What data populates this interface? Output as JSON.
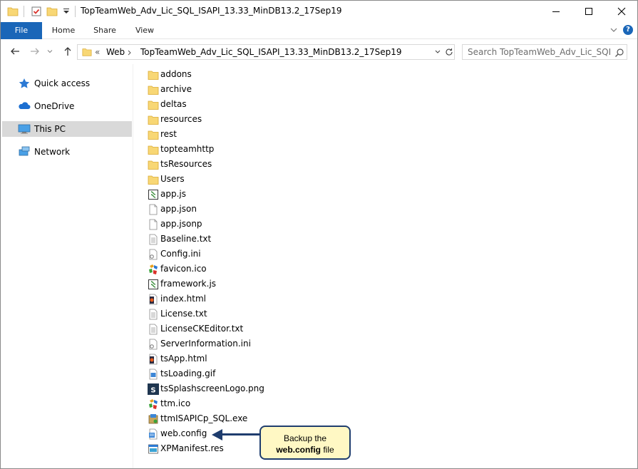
{
  "window": {
    "title": "TopTeamWeb_Adv_Lic_SQL_ISAPI_13.33_MinDB13.2_17Sep19",
    "minimize_icon": "minimize-icon",
    "maximize_icon": "maximize-icon",
    "close_icon": "close-icon"
  },
  "ribbon": {
    "tabs": [
      "File",
      "Home",
      "Share",
      "View"
    ],
    "help_label": "?"
  },
  "address": {
    "overflow": "«",
    "crumbs": [
      "Web",
      "TopTeamWeb_Adv_Lic_SQL_ISAPI_13.33_MinDB13.2_17Sep19"
    ],
    "search_placeholder": "Search TopTeamWeb_Adv_Lic_SQL_I..."
  },
  "navpane": {
    "items": [
      {
        "label": "Quick access",
        "icon": "star-icon"
      },
      {
        "label": "OneDrive",
        "icon": "cloud-icon"
      },
      {
        "label": "This PC",
        "icon": "computer-icon",
        "selected": true
      },
      {
        "label": "Network",
        "icon": "network-icon"
      }
    ]
  },
  "files": [
    {
      "name": "addons",
      "icon": "folder-icon"
    },
    {
      "name": "archive",
      "icon": "folder-icon"
    },
    {
      "name": "deltas",
      "icon": "folder-icon"
    },
    {
      "name": "resources",
      "icon": "folder-icon"
    },
    {
      "name": "rest",
      "icon": "folder-icon"
    },
    {
      "name": "topteamhttp",
      "icon": "folder-icon"
    },
    {
      "name": "tsResources",
      "icon": "folder-icon"
    },
    {
      "name": "Users",
      "icon": "folder-icon"
    },
    {
      "name": "app.js",
      "icon": "script-icon"
    },
    {
      "name": "app.json",
      "icon": "blank-file-icon"
    },
    {
      "name": "app.jsonp",
      "icon": "blank-file-icon"
    },
    {
      "name": "Baseline.txt",
      "icon": "text-file-icon"
    },
    {
      "name": "Config.ini",
      "icon": "settings-file-icon"
    },
    {
      "name": "favicon.ico",
      "icon": "ico-file-icon"
    },
    {
      "name": "framework.js",
      "icon": "script-icon"
    },
    {
      "name": "index.html",
      "icon": "html-file-icon"
    },
    {
      "name": "License.txt",
      "icon": "text-file-icon"
    },
    {
      "name": "LicenseCKEditor.txt",
      "icon": "text-file-icon"
    },
    {
      "name": "ServerInformation.ini",
      "icon": "settings-file-icon"
    },
    {
      "name": "tsApp.html",
      "icon": "html-file-icon"
    },
    {
      "name": "tsLoading.gif",
      "icon": "image-file-icon"
    },
    {
      "name": "tsSplashscreenLogo.png",
      "icon": "ts-logo-icon"
    },
    {
      "name": "ttm.ico",
      "icon": "ico-file-icon"
    },
    {
      "name": "ttmISAPICp_SQL.exe",
      "icon": "exe-file-icon"
    },
    {
      "name": "web.config",
      "icon": "config-file-icon"
    },
    {
      "name": "XPManifest.res",
      "icon": "res-file-icon"
    }
  ],
  "callout": {
    "line1": "Backup the",
    "bold": "web.config",
    "line2_suffix": " file"
  }
}
